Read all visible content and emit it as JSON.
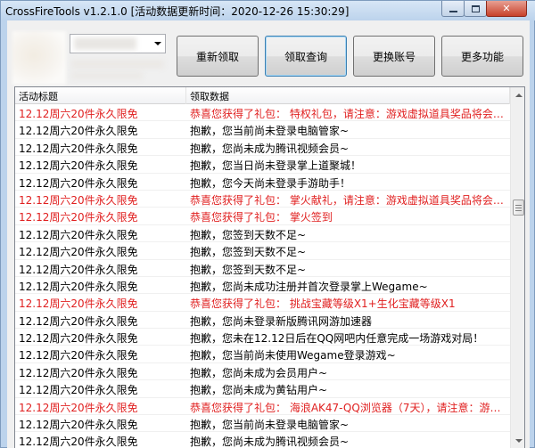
{
  "window": {
    "title": "CrossFireTools v1.2.1.0 [活动数据更新时间：2020-12-26 15:30:29]",
    "minimize_glyph": "–",
    "maximize_glyph": "□",
    "close_glyph": "✕"
  },
  "toolbar": {
    "refresh_label": "重新领取",
    "query_label": "领取查询",
    "switch_account_label": "更换账号",
    "more_label": "更多功能"
  },
  "list": {
    "columns": [
      "活动标题",
      "领取数据"
    ],
    "rows": [
      {
        "title": "12.12周六20件永久限免",
        "data": "恭喜您获得了礼包： 特权礼包，请注意：游戏虚拟道具奖品将会在24...",
        "highlight": true
      },
      {
        "title": "12.12周六20件永久限免",
        "data": "抱歉，您当前尚未登录电脑管家~",
        "highlight": false
      },
      {
        "title": "12.12周六20件永久限免",
        "data": "抱歉，您尚未成为腾讯视频会员~",
        "highlight": false
      },
      {
        "title": "12.12周六20件永久限免",
        "data": "抱歉，您当日尚未登录掌上道聚城！",
        "highlight": false
      },
      {
        "title": "12.12周六20件永久限免",
        "data": "抱歉，您今天尚未登录手游助手！",
        "highlight": false
      },
      {
        "title": "12.12周六20件永久限免",
        "data": "恭喜您获得了礼包： 掌火献礼，请注意：游戏虚拟道具奖品将会在24...",
        "highlight": true
      },
      {
        "title": "12.12周六20件永久限免",
        "data": "恭喜您获得了礼包： 掌火签到",
        "highlight": true
      },
      {
        "title": "12.12周六20件永久限免",
        "data": "抱歉，您签到天数不足~",
        "highlight": false
      },
      {
        "title": "12.12周六20件永久限免",
        "data": "抱歉，您签到天数不足~",
        "highlight": false
      },
      {
        "title": "12.12周六20件永久限免",
        "data": "抱歉，您签到天数不足~",
        "highlight": false
      },
      {
        "title": "12.12周六20件永久限免",
        "data": "抱歉，您尚未成功注册并首次登录掌上Wegame~",
        "highlight": false
      },
      {
        "title": "12.12周六20件永久限免",
        "data": "恭喜您获得了礼包： 挑战宝藏等级X1+生化宝藏等级X1",
        "highlight": true
      },
      {
        "title": "12.12周六20件永久限免",
        "data": "抱歉，您尚未登录新版腾讯网游加速器",
        "highlight": false
      },
      {
        "title": "12.12周六20件永久限免",
        "data": "抱歉，您未在12.12日后在QQ网吧内任意完成一场游戏对局！",
        "highlight": false
      },
      {
        "title": "12.12周六20件永久限免",
        "data": "抱歉，您当前尚未使用Wegame登录游戏~",
        "highlight": false
      },
      {
        "title": "12.12周六20件永久限免",
        "data": "抱歉，您尚未成为会员用户~",
        "highlight": false
      },
      {
        "title": "12.12周六20件永久限免",
        "data": "抱歉，您尚未成为黄钻用户~",
        "highlight": false
      },
      {
        "title": "12.12周六20件永久限免",
        "data": "恭喜您获得了礼包： 海浪AK47-QQ浏览器（7天），请注意：游戏虚...",
        "highlight": true
      },
      {
        "title": "12.12周六20件永久限免",
        "data": "抱歉，您当前尚未登录电脑管家~",
        "highlight": false
      },
      {
        "title": "12.12周六20件永久限免",
        "data": "抱歉，您尚未成为腾讯视频会员~",
        "highlight": false
      }
    ]
  },
  "colors": {
    "highlight_text": "#e01f1f",
    "normal_text": "#000000",
    "titlebar": "#bcd3ec",
    "close_button": "#c7412b"
  },
  "icons": {
    "minimize": "minimize-icon",
    "maximize": "maximize-icon",
    "close": "close-icon",
    "combo_arrow": "chevron-down-icon",
    "scroll_up": "arrow-up-icon",
    "scroll_down": "arrow-down-icon"
  }
}
